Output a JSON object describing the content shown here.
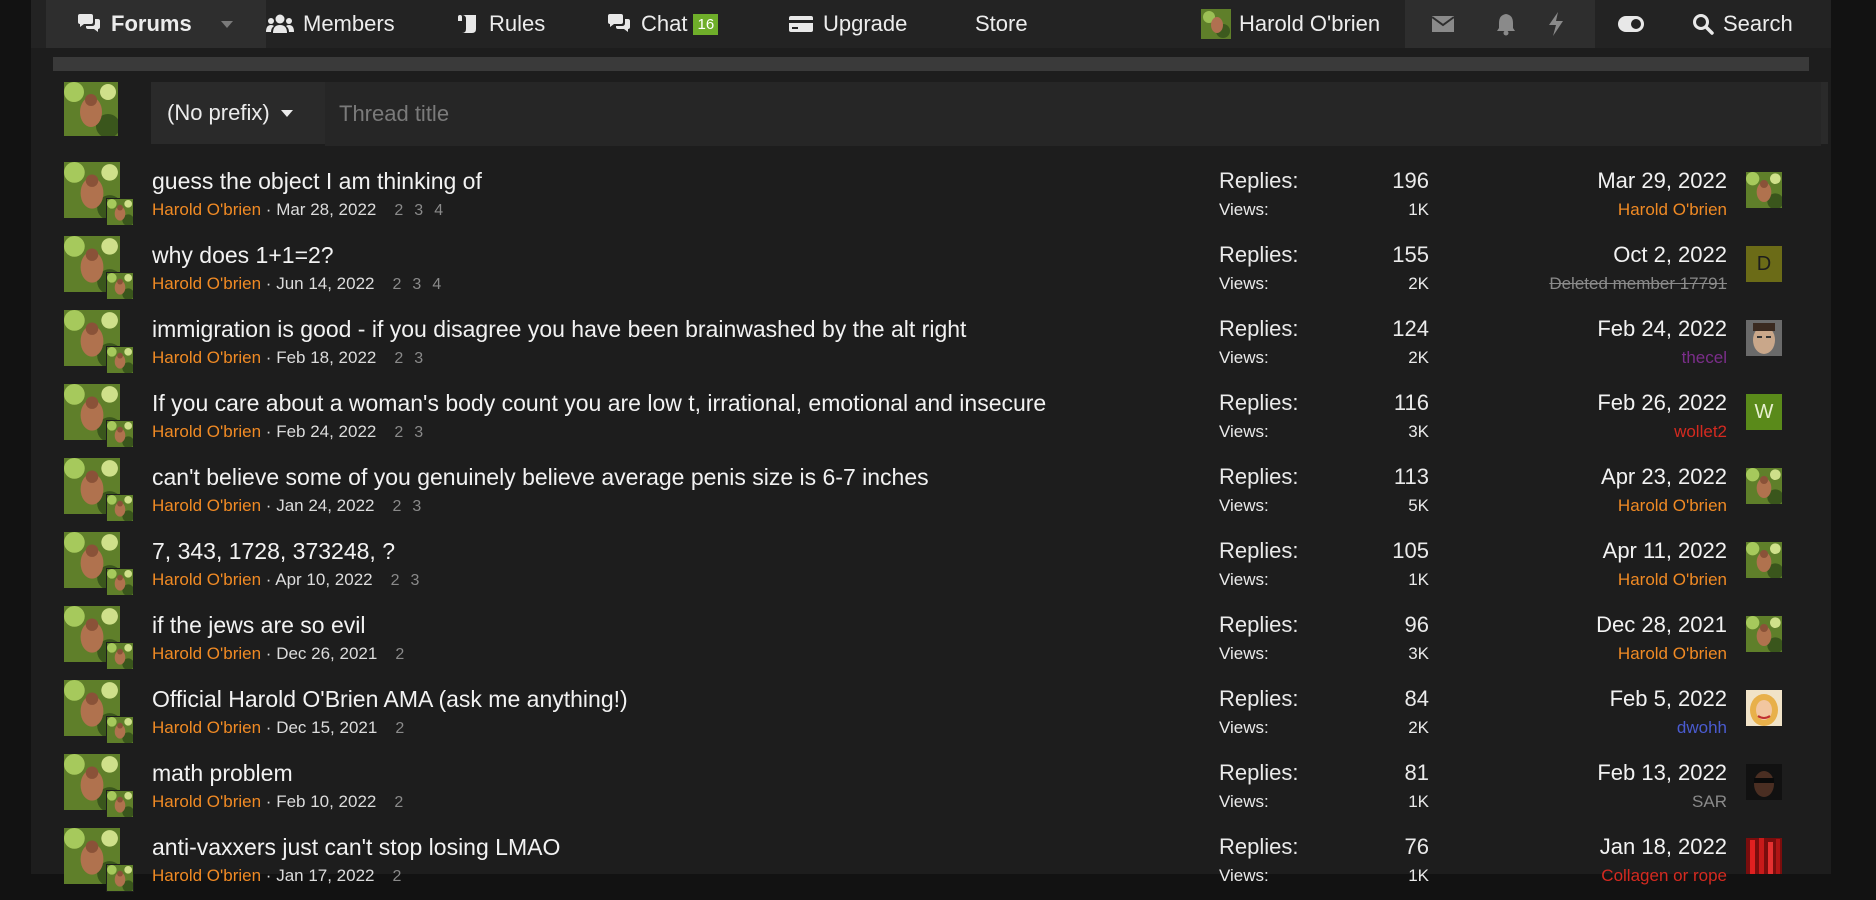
{
  "nav": {
    "forums": "Forums",
    "members": "Members",
    "rules": "Rules",
    "chat": "Chat",
    "chat_badge": "16",
    "upgrade": "Upgrade",
    "store": "Store",
    "user": "Harold O'brien",
    "search": "Search"
  },
  "form": {
    "prefix": "(No prefix)",
    "title_placeholder": "Thread title"
  },
  "labels": {
    "replies": "Replies:",
    "views": "Views:"
  },
  "threads": [
    {
      "title": "guess the object I am thinking of",
      "author": "Harold O'brien",
      "date": "Mar 28, 2022",
      "pages": [
        "2",
        "3",
        "4"
      ],
      "replies": "196",
      "views": "1K",
      "last_date": "Mar 29, 2022",
      "last_user": "Harold O'brien",
      "last_user_color": "#f08a24",
      "last_avatar": "photo"
    },
    {
      "title": "why does 1+1=2?",
      "author": "Harold O'brien",
      "date": "Jun 14, 2022",
      "pages": [
        "2",
        "3",
        "4"
      ],
      "replies": "155",
      "views": "2K",
      "last_date": "Oct 2, 2022",
      "last_user": "Deleted member 17791",
      "last_user_color": "#8a8a8a",
      "last_avatar": "letter",
      "last_avatar_letter": "D",
      "last_avatar_color": "#6b6b17"
    },
    {
      "title": "immigration is good - if you disagree you have been brainwashed by the alt right",
      "author": "Harold O'brien",
      "date": "Feb 18, 2022",
      "pages": [
        "2",
        "3"
      ],
      "replies": "124",
      "views": "2K",
      "last_date": "Feb 24, 2022",
      "last_user": "thecel",
      "last_user_color": "#7b2e8a",
      "last_avatar": "face"
    },
    {
      "title": "If you care about a woman's body count you are low t, irrational, emotional and insecure",
      "author": "Harold O'brien",
      "date": "Feb 24, 2022",
      "pages": [
        "2",
        "3"
      ],
      "replies": "116",
      "views": "3K",
      "last_date": "Feb 26, 2022",
      "last_user": "wollet2",
      "last_user_color": "#d42a20",
      "last_avatar": "letter",
      "last_avatar_letter": "W",
      "last_avatar_color": "#5a8a1a"
    },
    {
      "title": "can't believe some of you genuinely believe average penis size is 6-7 inches",
      "author": "Harold O'brien",
      "date": "Jan 24, 2022",
      "pages": [
        "2",
        "3"
      ],
      "replies": "113",
      "views": "5K",
      "last_date": "Apr 23, 2022",
      "last_user": "Harold O'brien",
      "last_user_color": "#f08a24",
      "last_avatar": "photo"
    },
    {
      "title": "7, 343, 1728, 373248, ?",
      "author": "Harold O'brien",
      "date": "Apr 10, 2022",
      "pages": [
        "2",
        "3"
      ],
      "replies": "105",
      "views": "1K",
      "last_date": "Apr 11, 2022",
      "last_user": "Harold O'brien",
      "last_user_color": "#f08a24",
      "last_avatar": "photo"
    },
    {
      "title": "if the jews are so evil",
      "author": "Harold O'brien",
      "date": "Dec 26, 2021",
      "pages": [
        "2"
      ],
      "replies": "96",
      "views": "3K",
      "last_date": "Dec 28, 2021",
      "last_user": "Harold O'brien",
      "last_user_color": "#f08a24",
      "last_avatar": "photo"
    },
    {
      "title": "Official Harold O'Brien AMA (ask me anything!)",
      "author": "Harold O'brien",
      "date": "Dec 15, 2021",
      "pages": [
        "2"
      ],
      "replies": "84",
      "views": "2K",
      "last_date": "Feb 5, 2022",
      "last_user": "dwohh",
      "last_user_color": "#4a5bd0",
      "last_avatar": "blonde"
    },
    {
      "title": "math problem",
      "author": "Harold O'brien",
      "date": "Feb 10, 2022",
      "pages": [
        "2"
      ],
      "replies": "81",
      "views": "1K",
      "last_date": "Feb 13, 2022",
      "last_user": "SAR",
      "last_user_color": "#8a8a8a",
      "last_avatar": "dark"
    },
    {
      "title": "anti-vaxxers just can't stop losing LMAO",
      "author": "Harold O'brien",
      "date": "Jan 17, 2022",
      "pages": [
        "2"
      ],
      "replies": "76",
      "views": "1K",
      "last_date": "Jan 18, 2022",
      "last_user": "Collagen or rope",
      "last_user_color": "#d42a20",
      "last_avatar": "red"
    }
  ]
}
